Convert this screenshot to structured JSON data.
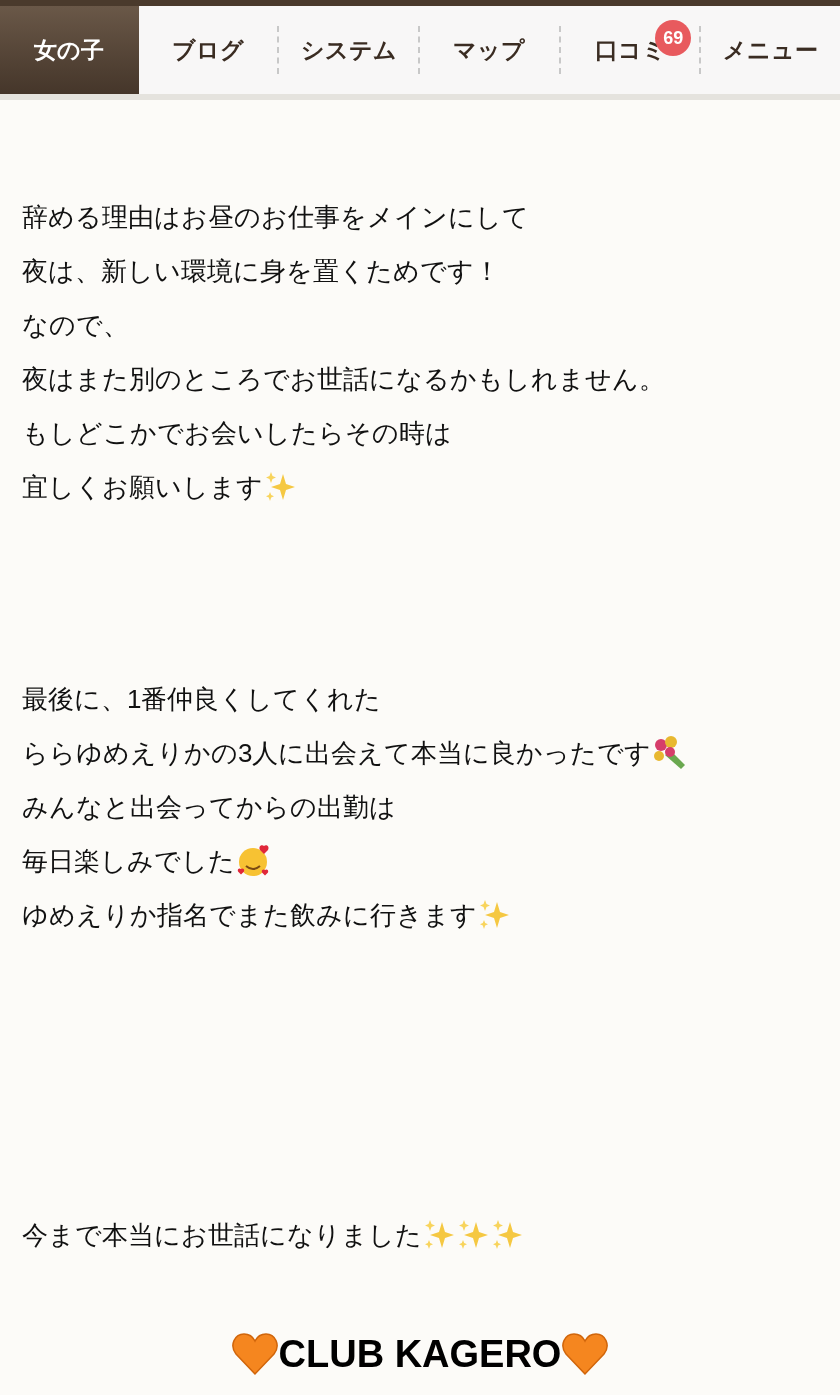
{
  "tabs": [
    {
      "label": "女の子",
      "selected": true
    },
    {
      "label": "ブログ",
      "selected": false
    },
    {
      "label": "システム",
      "selected": false
    },
    {
      "label": "マップ",
      "selected": false
    },
    {
      "label": "口コミ",
      "selected": false,
      "badge": "69"
    },
    {
      "label": "メニュー",
      "selected": false
    }
  ],
  "paragraphs": [
    {
      "lines": [
        {
          "text": "辞める理由はお昼のお仕事をメインにして",
          "kind": "plain"
        },
        {
          "text": "夜は、新しい環境に身を置くためです！",
          "kind": "plain"
        },
        {
          "text": "なので、",
          "kind": "plain"
        },
        {
          "text": "夜はまた別のところでお世話になるかもしれません。",
          "kind": "plain"
        },
        {
          "text": "もしどこかでお会いしたらその時は",
          "kind": "plain"
        },
        {
          "text": "宜しくお願いします",
          "kind": "sparkles"
        }
      ]
    },
    {
      "lines": [
        {
          "text": "最後に、1番仲良くしてくれた",
          "kind": "plain"
        },
        {
          "text": "ららゆめえりかの3人に出会えて本当に良かったです",
          "kind": "bouquet"
        },
        {
          "text": "みんなと出会ってからの出勤は",
          "kind": "plain"
        },
        {
          "text": "毎日楽しみでした",
          "kind": "hearts-face"
        },
        {
          "text": "ゆめえりか指名でまた飲みに行きます",
          "kind": "sparkles"
        }
      ]
    },
    {
      "lines": [
        {
          "text": "今まで本当にお世話になりました",
          "kind": "triple-sparkles"
        }
      ]
    }
  ],
  "footer": {
    "title": "CLUB KAGERO"
  }
}
